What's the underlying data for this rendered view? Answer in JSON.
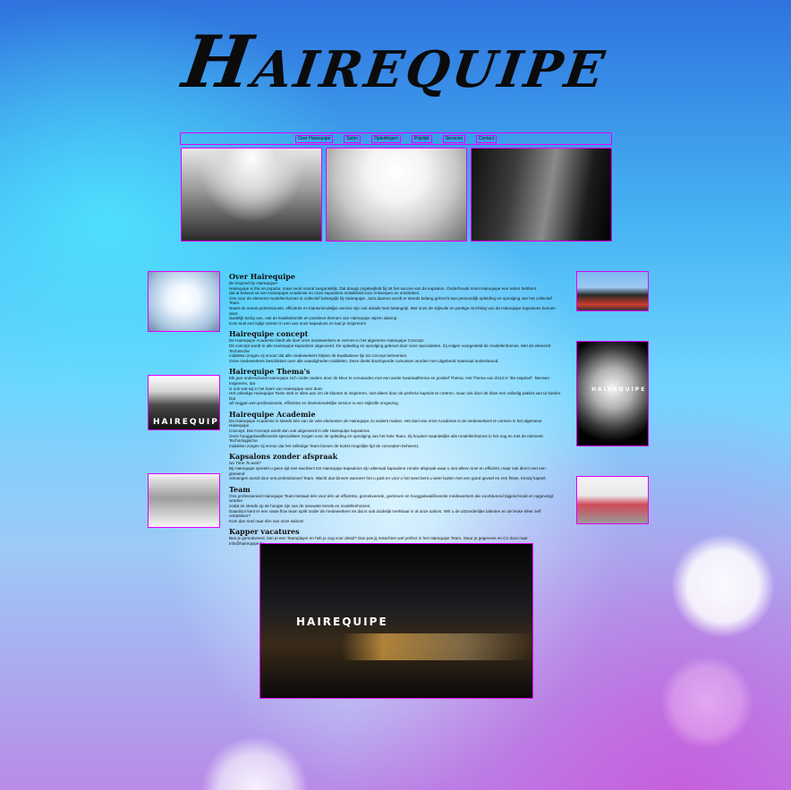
{
  "site": {
    "logo": "Hairequipe"
  },
  "nav": [
    "Over Hairequipe",
    "Salon",
    "Opleidingen",
    "Prijslijst",
    "Services",
    "Contact"
  ],
  "gallery_top": [
    {
      "alt": "salon interieur",
      "icon": "photo"
    },
    {
      "alt": "salon lichtplafond",
      "icon": "photo"
    },
    {
      "alt": "gevel Hairequipe",
      "icon": "photo"
    }
  ],
  "signage": {
    "facade_small": "HAIREQUIPE",
    "fisheye": "HAIREQUIPE",
    "night": "HAIREQUIPE"
  },
  "sections": [
    {
      "heading": "Over Hairequipe",
      "subheading": "Be inspired by Hairequipe!",
      "lines": [
        "Hairequipe is tha ne popular, maar veral vooral toegankelijk. Dat draagt ongetwijfeld bij tot het succes van de kapsalon. Onderhouds moet Hairequipe een reden hebben!",
        "dat al bekend uit een Hairequipe Academie en onze kapsalons ontwikkeld voor Antwerpen en omstreken.",
        "Ons voor de elementt modellenhomes in collectief belangrijk bij Hairequipe. Juist daarom wordt er steeds belang gehecht aan persoonlijk opleiding en opvolging van het collectief Team.",
        "Naast de meest professionele, efficiënte en klantvriendelijke service zijn ook details heel belangrijk. Met onze de stijlvolle en prettige inrichting van de Hairequipe kapsalons kunnen deze",
        "duidelijk bezig van, ook de kwaliteitsrolle en positieve thema's van Hairequipe wijzen daarop.",
        "Kom snel een kijkje nemen in een van onze kapsalons en laat je inspireren!"
      ]
    },
    {
      "heading": "Hairequipe concept",
      "lines": [
        "De Hairequipe Academie biedt als doel onze medewerkers te vormen in het algemene Hairequipe Concept.",
        "Dit concept wordt in alle Hairequipe kapsalons uitgevoerd. De opleiding en opvolging gebeurt door onze specialisten. Zij volgen voorgesteld de modellenhomes. Met de elementt Technische",
        "middelen zorgen zij ervoor dat alle medewerkers blijven de kwalitatieve lijn tot concept beheersen.",
        "Onze medewerkers beschikken over alle vaardigheden middelen. Deze direkt doorlopende cursussen worden met uitgebreid materiaal ondersteund."
      ]
    },
    {
      "heading": "Hairequipe Thema's",
      "lines": [
        "Elk jaar onderscheidt Hairequipe zich onder andere door de kleur te vervaarden met een ander kwartaalthema en positief Thema. Het Thema van 2013 is \"Be inspired\". Mensen inspireren, dat",
        "is ook wat wij in het team van Hairequipe voor doet.",
        "Het volledige Hairequipe Team stelt er alles aan om de klanten te inspireren, niet alleen door de perfecte kapsels te creëren, maar ook door de klant een volledig pakket aan te bieden. Dat",
        "wil zeggen een professionele, efficiënte en klantvriendelijke service in een stijlvolle omgeving."
      ]
    },
    {
      "heading": "Hairequipe Academie",
      "lines": [
        "De Hairequipe Academie is steeds één van de vele elementen de Hairequipe zo anders maken. Het doel van onze Academie is de medewerkers te vormen in het algemene Hairequipe",
        "Concept. Dat Concept wordt dan ook uitgevoerd in alle Hairequipe kapsalons.",
        "Onze hooggekwalificeerde specialisten zorgen voor de opleiding en opvolging van het hele Team. Zij houden maandelijks alle modellenhomes in het oog en met de elementt Technologische",
        "middelen zorgen zij ervoor dat het volledige Team binnen de kortst mogelijke tijd de concepten beheerst."
      ]
    },
    {
      "heading": "Kapsalons zonder afspraak",
      "subheading": "No Time To wait?",
      "lines": [
        "Bij Hairequipe spreekt u geen tijd met wachten! De Hairequipe kapsalons zijn allemaal kapsalons zonder afspraak waar u niet alleen snel en efficiënt, maar ook direct met een gloeiend",
        "ontvangen wordt door ons professioneel Team. Wacht dus binnen wanneer het u past en voor u het weet bent u weer buiten met een goed gevoel en een frisse, trendy kapsel."
      ]
    },
    {
      "heading": "Team",
      "lines": [
        "Ons professioneel Hairequipe Team bestaat één voor één uit efficiënte, gemotiveerde, gedreven en hooggekwalificeerde medewerkers die voortdurend bijgeschoold en opgevolgd worden",
        "zodat ze steeds op de hoogte zijn van de nieuwste trends en modellenhomes.",
        "Daardoor kent er een vaste flow team spirit onder de medewerkers en dat is ook duidelijk merkbaar in al onze salons. Wilt u de uitzonderlijke talenten en de leuke sfeer zelf ontdekken?",
        "Kom dan snel naar één van onze salons!"
      ]
    },
    {
      "heading": "Kapper vacatures",
      "lines": [
        "Ben je gemotiveerd, ben je een Teamplayer en heb je oog voor detail? Dan pas jij misschien wel perfect in het Hairequipe Team. Stuur je gegevens en CV door naar info@hairequipe.be."
      ]
    }
  ],
  "colors": {
    "outline": "#e100ff",
    "logo": "#0b0b0b"
  }
}
